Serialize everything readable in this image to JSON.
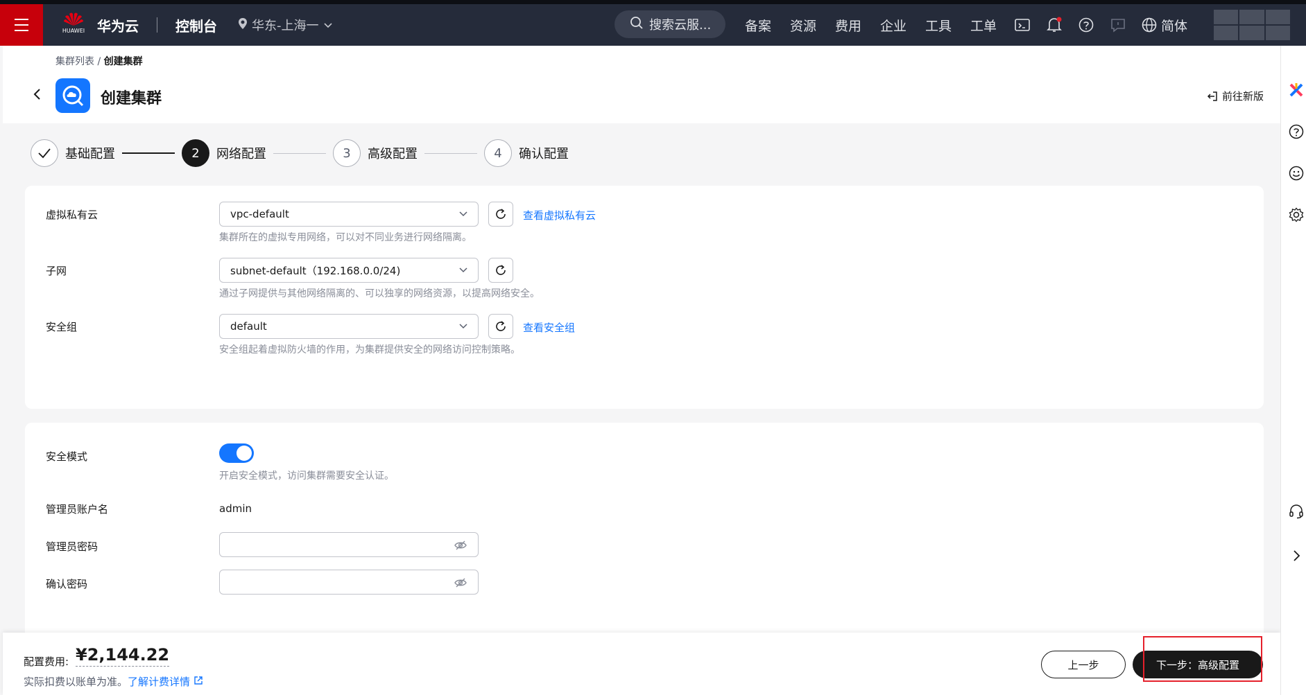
{
  "topbar": {
    "logo_word": "HUAWEI",
    "brand": "华为云",
    "console": "控制台",
    "region": "华东-上海一",
    "search_placeholder": "搜索云服...",
    "links": [
      "备案",
      "资源",
      "费用",
      "企业",
      "工具",
      "工单"
    ],
    "lang": "简体"
  },
  "header": {
    "breadcrumb_parent": "集群列表",
    "breadcrumb_sep": "/",
    "breadcrumb_current": "创建集群",
    "title": "创建集群",
    "new_version": "前往新版"
  },
  "steps": [
    {
      "num": "",
      "label": "基础配置",
      "state": "done"
    },
    {
      "num": "2",
      "label": "网络配置",
      "state": "active"
    },
    {
      "num": "3",
      "label": "高级配置",
      "state": "todo"
    },
    {
      "num": "4",
      "label": "确认配置",
      "state": "todo"
    }
  ],
  "network": {
    "vpc": {
      "label": "虚拟私有云",
      "value": "vpc-default",
      "link": "查看虚拟私有云",
      "hint": "集群所在的虚拟专用网络，可以对不同业务进行网络隔离。"
    },
    "subnet": {
      "label": "子网",
      "value": "subnet-default（192.168.0.0/24)",
      "hint": "通过子网提供与其他网络隔离的、可以独享的网络资源，以提高网络安全。"
    },
    "sg": {
      "label": "安全组",
      "value": "default",
      "link": "查看安全组",
      "hint": "安全组起着虚拟防火墙的作用，为集群提供安全的网络访问控制策略。"
    }
  },
  "security": {
    "mode_label": "安全模式",
    "mode_on": true,
    "mode_hint": "开启安全模式，访问集群需要安全认证。",
    "admin_label": "管理员账户名",
    "admin_value": "admin",
    "pwd_label": "管理员密码",
    "confirm_label": "确认密码"
  },
  "footer": {
    "fee_label": "配置费用:",
    "fee_value": "¥2,144.22",
    "note": "实际扣费以账单为准。",
    "note_link": "了解计费详情",
    "prev": "上一步",
    "next": "下一步：高级配置"
  },
  "colors": {
    "accent": "#1476ff",
    "brand_red": "#c7000b",
    "topbar": "#252b3a",
    "highlight": "#e5202b"
  }
}
